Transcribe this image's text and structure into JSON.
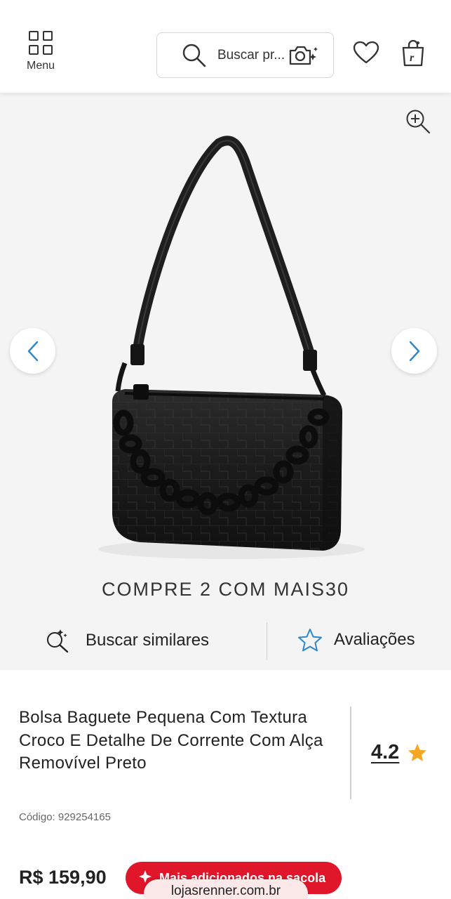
{
  "header": {
    "menu_label": "Menu",
    "search_placeholder": "Buscar  pr...",
    "icons": [
      "grid-menu-icon",
      "search-icon",
      "camera-search-icon",
      "heart-icon",
      "shopping-bag-icon"
    ]
  },
  "gallery": {
    "icons": [
      "zoom-in-icon",
      "chevron-left-icon",
      "chevron-right-icon"
    ]
  },
  "promo": {
    "text": "COMPRE 2 COM MAIS30"
  },
  "actions": {
    "similar_label": "Buscar similares",
    "reviews_label": "Avaliações"
  },
  "product": {
    "title": "Bolsa Baguete Pequena Com Textura Croco E Detalhe De Corrente Com Alça Removível Preto",
    "code": "Código: 929254165",
    "rating": "4.2",
    "price": "R$ 159,90"
  },
  "toast": {
    "text": "Mais adicionados na sacola"
  },
  "browser": {
    "url": "lojasrenner.com.br"
  },
  "colors": {
    "accent_red": "#e0162b",
    "star": "#f5a623",
    "arrow_blue": "#2f86c9",
    "background_gray": "#f4f4f4"
  }
}
